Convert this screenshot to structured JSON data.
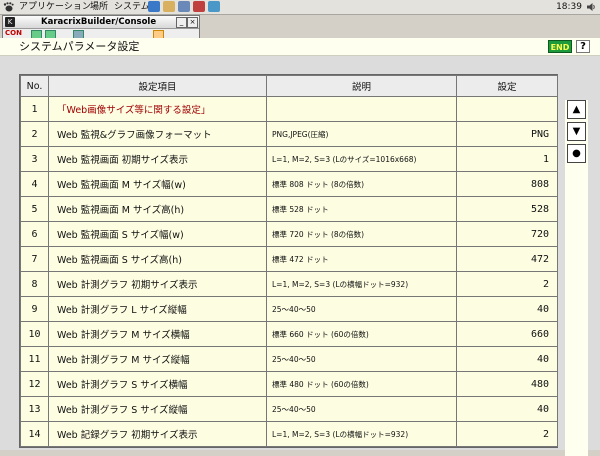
{
  "panel": {
    "menus": [
      "アプリケーション",
      "場所",
      "システム"
    ],
    "clock": "18:39"
  },
  "console": {
    "title": "KaracrixBuilder/Console",
    "min_label": "_",
    "close_label": "×",
    "toolbar_con": "CON"
  },
  "header": {
    "title": "システムパラメータ設定",
    "end_label": "END",
    "help_label": "?"
  },
  "table": {
    "headers": [
      "No.",
      "設定項目",
      "説明",
      "設定"
    ],
    "rows": [
      {
        "no": "1",
        "item": "「Web画像サイズ等に関する設定」",
        "desc": "",
        "val": ""
      },
      {
        "no": "2",
        "item": "Web 監視&グラフ画像フォーマット",
        "desc": "PNG,JPEG(圧縮)",
        "val": "PNG"
      },
      {
        "no": "3",
        "item": "Web 監視画面 初期サイズ表示",
        "desc": "L=1, M=2, S=3 (Lのサイズ=1016x668)",
        "val": "1"
      },
      {
        "no": "4",
        "item": "Web 監視画面 M サイズ幅(w)",
        "desc": "標準 808 ドット (8の倍数)",
        "val": "808"
      },
      {
        "no": "5",
        "item": "Web 監視画面 M サイズ高(h)",
        "desc": "標準 528 ドット",
        "val": "528"
      },
      {
        "no": "6",
        "item": "Web 監視画面 S サイズ幅(w)",
        "desc": "標準 720 ドット (8の倍数)",
        "val": "720"
      },
      {
        "no": "7",
        "item": "Web 監視画面 S サイズ高(h)",
        "desc": "標準 472 ドット",
        "val": "472"
      },
      {
        "no": "8",
        "item": "Web 計測グラフ 初期サイズ表示",
        "desc": "L=1, M=2, S=3 (Lの横幅ドット=932)",
        "val": "2"
      },
      {
        "no": "9",
        "item": "Web 計測グラフ L サイズ縦幅",
        "desc": "25〜40〜50",
        "val": "40"
      },
      {
        "no": "10",
        "item": "Web 計測グラフ M サイズ横幅",
        "desc": "標準 660 ドット (60の倍数)",
        "val": "660"
      },
      {
        "no": "11",
        "item": "Web 計測グラフ M サイズ縦幅",
        "desc": "25〜40〜50",
        "val": "40"
      },
      {
        "no": "12",
        "item": "Web 計測グラフ S サイズ横幅",
        "desc": "標準 480 ドット (60の倍数)",
        "val": "480"
      },
      {
        "no": "13",
        "item": "Web 計測グラフ S サイズ縦幅",
        "desc": "25〜40〜50",
        "val": "40"
      },
      {
        "no": "14",
        "item": "Web 記録グラフ 初期サイズ表示",
        "desc": "L=1, M=2, S=3 (Lの横幅ドット=932)",
        "val": "2"
      }
    ]
  },
  "scroll": {
    "up": "▲",
    "down": "▼",
    "dot": "●"
  },
  "colors": {
    "row_bg": "#fdfde2",
    "section_text": "#a00000",
    "end_bg": "#1c9a3c",
    "end_text": "#ffff50"
  }
}
